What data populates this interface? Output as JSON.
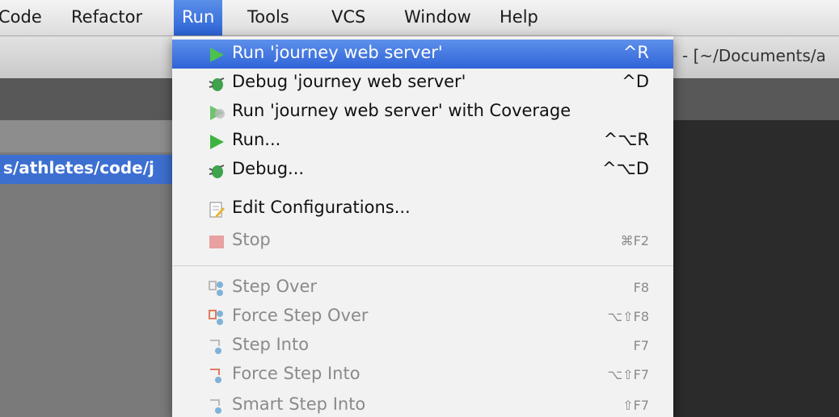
{
  "menubar": {
    "items": [
      "Code",
      "Refactor",
      "Run",
      "Tools",
      "VCS",
      "Window",
      "Help"
    ],
    "active": "Run"
  },
  "background": {
    "window_path": "- [~/Documents/a",
    "project_path": "s/athletes/code/j"
  },
  "run_menu": {
    "items": [
      {
        "label": "Run 'journey web server'",
        "shortcut": "^R",
        "icon": "run-play-icon",
        "highlighted": true,
        "enabled": true
      },
      {
        "label": "Debug 'journey web server'",
        "shortcut": "^D",
        "icon": "debug-bug-icon",
        "enabled": true
      },
      {
        "label": "Run 'journey web server' with Coverage",
        "shortcut": "",
        "icon": "coverage-icon",
        "enabled": true
      },
      {
        "label": "Run...",
        "shortcut": "^⌥R",
        "icon": "run-play-icon",
        "enabled": true
      },
      {
        "label": "Debug...",
        "shortcut": "^⌥D",
        "icon": "debug-bug-icon",
        "enabled": true
      },
      {
        "label": "Edit Configurations...",
        "shortcut": "",
        "icon": "edit-configurations-icon",
        "enabled": true
      },
      {
        "label": "Stop",
        "shortcut": "⌘F2",
        "icon": "stop-icon",
        "enabled": false
      },
      {
        "label": "Step Over",
        "shortcut": "F8",
        "icon": "step-over-icon",
        "enabled": false
      },
      {
        "label": "Force Step Over",
        "shortcut": "⌥⇧F8",
        "icon": "force-step-over-icon",
        "enabled": false
      },
      {
        "label": "Step Into",
        "shortcut": "F7",
        "icon": "step-into-icon",
        "enabled": false
      },
      {
        "label": "Force Step Into",
        "shortcut": "⌥⇧F7",
        "icon": "force-step-into-icon",
        "enabled": false
      },
      {
        "label": "Smart Step Into",
        "shortcut": "⇧F7",
        "icon": "smart-step-into-icon",
        "enabled": false
      }
    ]
  },
  "colors": {
    "highlight": "#3064d8",
    "run_green": "#3fb33f",
    "stop_red": "#e88a8a"
  }
}
